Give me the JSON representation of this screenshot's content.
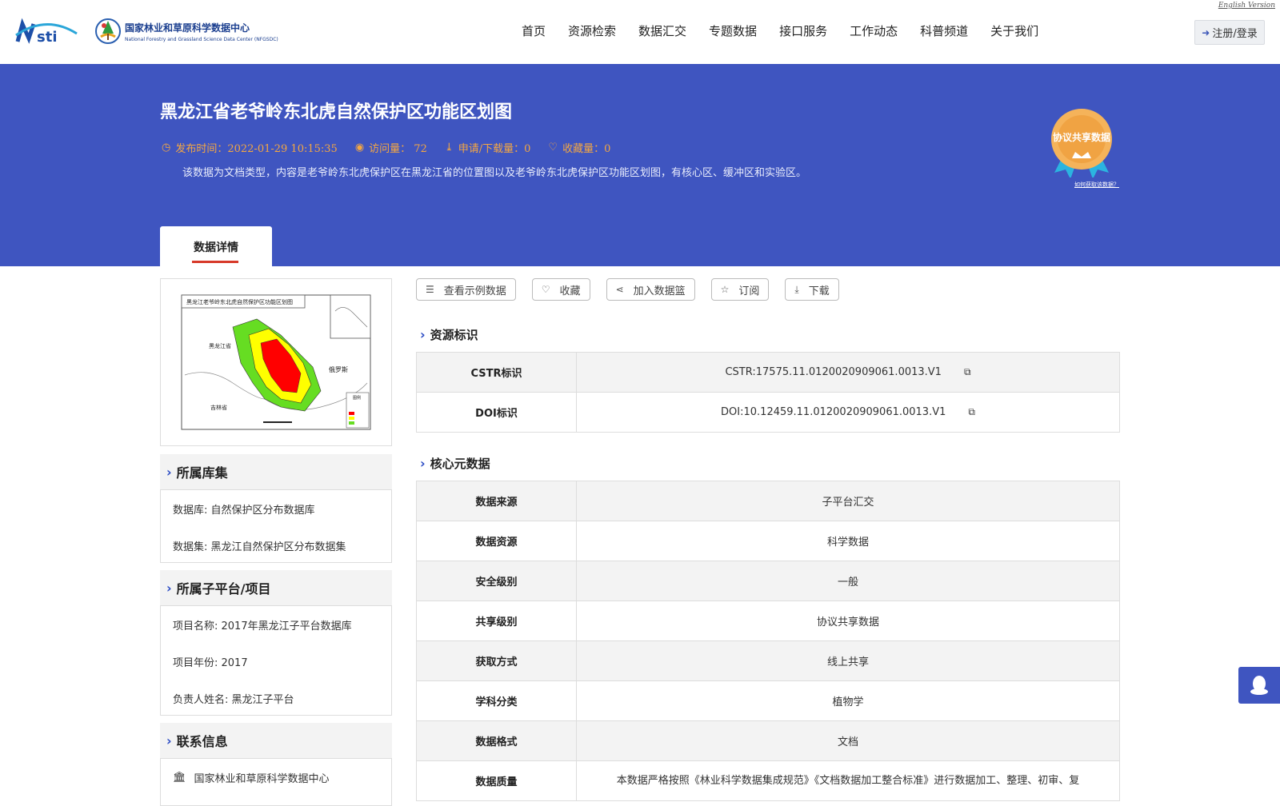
{
  "header": {
    "english_link": "English Version",
    "logo_nsti_text": "NSTI",
    "center_name_cn": "国家林业和草原科学数据中心",
    "center_name_en": "National Forestry and Grassland Science Data Center (NFGSDC)",
    "nav": [
      "首页",
      "资源检索",
      "数据汇交",
      "专题数据",
      "接口服务",
      "工作动态",
      "科普频道",
      "关于我们"
    ],
    "login_label": "注册/登录"
  },
  "banner": {
    "title": "黑龙江省老爷岭东北虎自然保护区功能区划图",
    "publish_time": "发布时间：2022-01-29 10:15:35",
    "visits": "访问量： 72",
    "downloads": "申请/下载量：0",
    "favorites": "收藏量：0",
    "description": "该数据为文档类型，内容是老爷岭东北虎保护区在黑龙江省的位置图以及老爷岭东北虎保护区功能区划图，有核心区、缓冲区和实验区。",
    "badge_label": "协议共享数据",
    "how_to_link": "如何获取该数据？",
    "tab_label": "数据详情"
  },
  "thumbnail": {
    "map_title": "黑龙江老爷岭东北虎自然保护区功能区划图",
    "label_heilongjiang": "黑龙江省",
    "label_russia": "俄罗斯",
    "label_jilin": "吉林省",
    "legend_title": "图例",
    "colors": {
      "core": "#ff0000",
      "buffer": "#ffff00",
      "experiment": "#66dd22"
    }
  },
  "sidebar": {
    "collection_title": "所属库集",
    "database": "数据库: 自然保护区分布数据库",
    "dataset": "数据集: 黑龙江自然保护区分布数据集",
    "project_title": "所属子平台/项目",
    "project_name": "项目名称: 2017年黑龙江子平台数据库",
    "project_year": "项目年份: 2017",
    "project_owner": "负责人姓名: 黑龙江子平台",
    "contact_title": "联系信息",
    "contact_org": "国家林业和草原科学数据中心"
  },
  "actions": [
    "查看示例数据",
    "收藏",
    "加入数据篮",
    "订阅",
    "下载"
  ],
  "resource_id": {
    "title": "资源标识",
    "rows": [
      {
        "key": "CSTR标识",
        "value": "CSTR:17575.11.0120020909061.0013.V1"
      },
      {
        "key": "DOI标识",
        "value": "DOI:10.12459.11.0120020909061.0013.V1"
      }
    ]
  },
  "core_meta": {
    "title": "核心元数据",
    "rows": [
      {
        "key": "数据来源",
        "value": "子平台汇交"
      },
      {
        "key": "数据资源",
        "value": "科学数据"
      },
      {
        "key": "安全级别",
        "value": "一般"
      },
      {
        "key": "共享级别",
        "value": "协议共享数据"
      },
      {
        "key": "获取方式",
        "value": "线上共享"
      },
      {
        "key": "学科分类",
        "value": "植物学"
      },
      {
        "key": "数据格式",
        "value": "文档"
      },
      {
        "key": "数据质量",
        "value": "本数据严格按照《林业科学数据集成规范》《文档数据加工整合标准》进行数据加工、整理、初审、复"
      }
    ]
  },
  "theme": {
    "accent": "#3f55c0",
    "highlight": "#f4a742",
    "tab_underline": "#d73a2a"
  }
}
